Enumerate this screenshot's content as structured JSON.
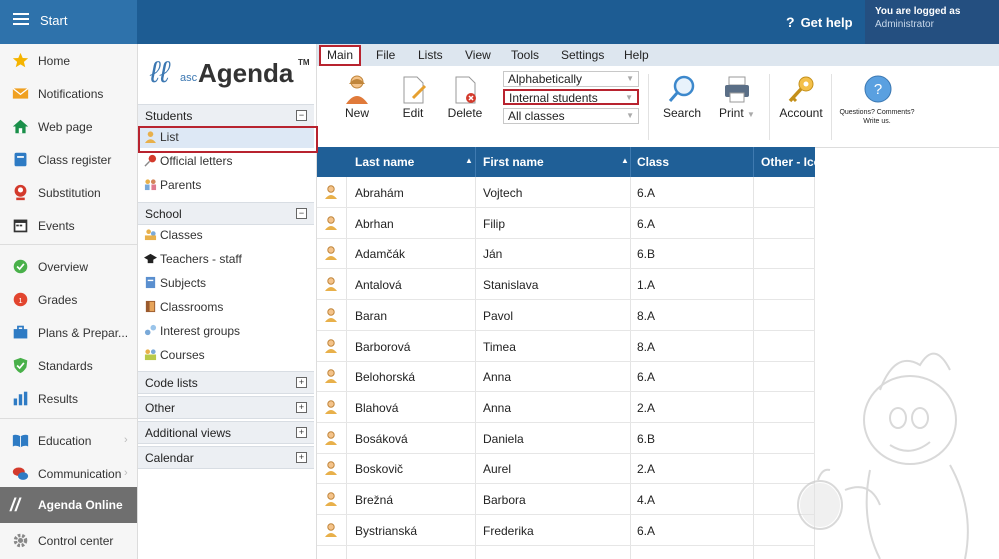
{
  "topbar": {
    "start_label": "Start",
    "help_label": "Get help",
    "logged_line1": "You are logged as",
    "logged_line2": "Administrator"
  },
  "sidebar": {
    "items": [
      {
        "label": "Home",
        "icon": "star-icon",
        "color": "#f5b400"
      },
      {
        "label": "Notifications",
        "icon": "envelope-icon",
        "color": "#f0a020"
      },
      {
        "label": "Web page",
        "icon": "house-icon",
        "color": "#1a8f4a"
      },
      {
        "label": "Class register",
        "icon": "register-icon",
        "color": "#2e7bc4"
      },
      {
        "label": "Substitution",
        "icon": "substitution-icon",
        "color": "#d33a2c"
      },
      {
        "label": "Events",
        "icon": "calendar-icon",
        "color": "#333333"
      },
      {
        "label": "Overview",
        "icon": "check-circle-icon",
        "color": "#49b04a"
      },
      {
        "label": "Grades",
        "icon": "grades-icon",
        "color": "#e2452f"
      },
      {
        "label": "Plans & Prepar...",
        "icon": "briefcase-icon",
        "color": "#2e7bc4"
      },
      {
        "label": "Standards",
        "icon": "shield-check-icon",
        "color": "#49b04a"
      },
      {
        "label": "Results",
        "icon": "bar-chart-icon",
        "color": "#2e7bc4"
      },
      {
        "label": "Education",
        "icon": "book-icon",
        "color": "#2e7bc4"
      },
      {
        "label": "Communication",
        "icon": "chat-icon",
        "color": "#d33a2c"
      },
      {
        "label": "Agenda Online",
        "icon": "agenda-feather-icon",
        "color": "#ffffff"
      },
      {
        "label": "Control center",
        "icon": "gear-icon",
        "color": "#888888"
      }
    ]
  },
  "leftpanel": {
    "logo_asc": "asc",
    "logo_agenda": "Agenda",
    "logo_tm": "TM",
    "students_header": "Students",
    "students_items": [
      "List",
      "Official letters",
      "Parents"
    ],
    "school_header": "School",
    "school_items": [
      "Classes",
      "Teachers - staff",
      "Subjects",
      "Classrooms",
      "Interest groups",
      "Courses"
    ],
    "collapsed_headers": [
      "Code lists",
      "Other",
      "Additional views",
      "Calendar"
    ],
    "minus": "⊟",
    "plus": "⊞"
  },
  "ribbon": {
    "menu": [
      "Main",
      "File",
      "Lists",
      "View",
      "Tools",
      "Settings",
      "Help"
    ],
    "buttons": {
      "new": "New",
      "edit": "Edit",
      "delete": "Delete",
      "search": "Search",
      "print": "Print",
      "account": "Account"
    },
    "dropdowns": [
      "Alphabetically",
      "Internal students",
      "All classes"
    ],
    "question_text": "Questions? Comments? Write us."
  },
  "grid": {
    "columns": [
      "Last name",
      "First name",
      "Class",
      "Other - Ico"
    ],
    "rows": [
      [
        "Abrahám",
        "Vojtech",
        "6.A"
      ],
      [
        "Abrhan",
        "Filip",
        "6.A"
      ],
      [
        "Adamčák",
        "Ján",
        "6.B"
      ],
      [
        "Antalová",
        "Stanislava",
        "1.A"
      ],
      [
        "Baran",
        "Pavol",
        "8.A"
      ],
      [
        "Barborová",
        "Timea",
        "8.A"
      ],
      [
        "Belohorská",
        "Anna",
        "6.A"
      ],
      [
        "Blahová",
        "Anna",
        "2.A"
      ],
      [
        "Bosáková",
        "Daniela",
        "6.B"
      ],
      [
        "Boskovič",
        "Aurel",
        "2.A"
      ],
      [
        "Brežná",
        "Barbora",
        "4.A"
      ],
      [
        "Bystrianská",
        "Frederika",
        "6.A"
      ]
    ]
  }
}
